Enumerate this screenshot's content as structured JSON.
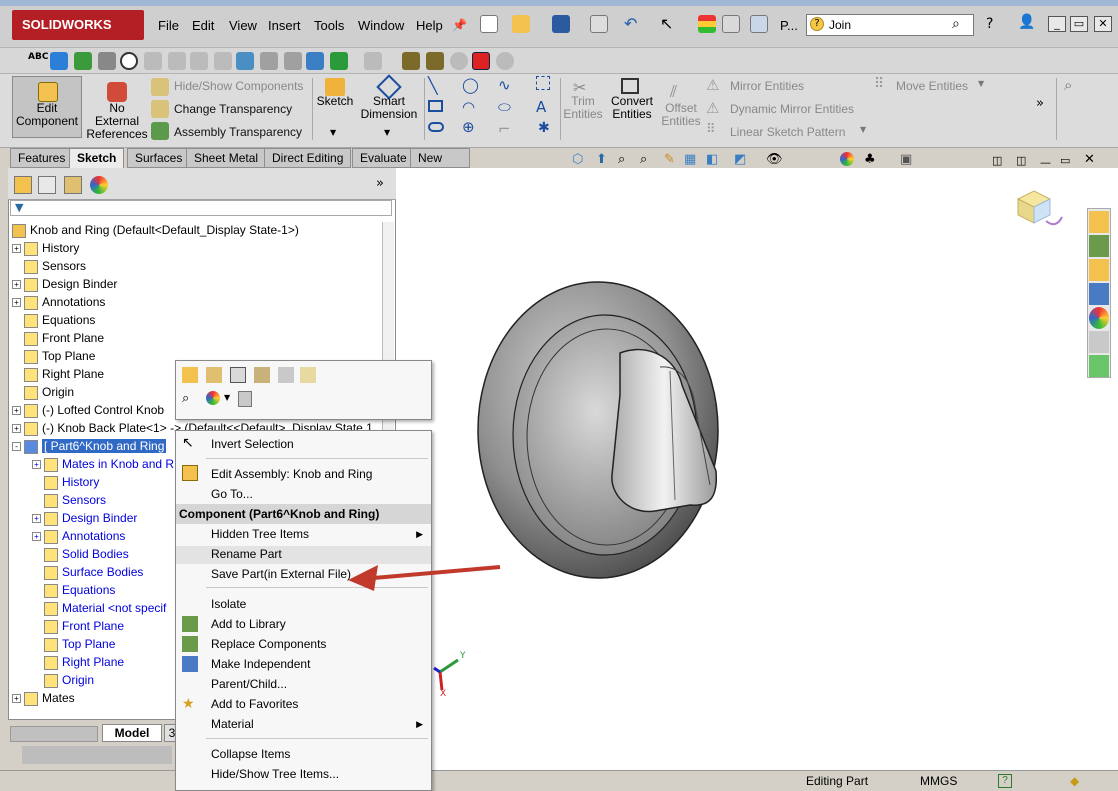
{
  "app": {
    "title": "SOLIDWORKS",
    "search_placeholder": "Join"
  },
  "menubar": {
    "items": [
      "File",
      "Edit",
      "View",
      "Insert",
      "Tools",
      "Window",
      "Help",
      "P..."
    ]
  },
  "ribbon": {
    "edit_component": "Edit Component",
    "no_external_references": "No External References",
    "hide_show_components": "Hide/Show Components",
    "change_transparency": "Change Transparency",
    "assembly_transparency": "Assembly Transparency",
    "sketch": "Sketch",
    "smart_dimension": "Smart Dimension",
    "trim_entities": "Trim Entities",
    "convert_entities": "Convert Entities",
    "offset_entities": "Offset Entities",
    "mirror_entities": "Mirror Entities",
    "dynamic_mirror_entities": "Dynamic Mirror Entities",
    "linear_sketch_pattern": "Linear Sketch Pattern",
    "move_entities": "Move Entities"
  },
  "tabs": [
    "Features",
    "Sketch",
    "Surfaces",
    "Sheet Metal",
    "Direct Editing",
    "Evaluate",
    "New Tab"
  ],
  "tree": {
    "root": "Knob and Ring  (Default<Default_Display State-1>)",
    "items": [
      {
        "label": "History",
        "expand": "+",
        "color": "black"
      },
      {
        "label": "Sensors",
        "expand": "",
        "color": "black"
      },
      {
        "label": "Design Binder",
        "expand": "+",
        "color": "black"
      },
      {
        "label": "Annotations",
        "expand": "+",
        "color": "black"
      },
      {
        "label": "Equations",
        "expand": "",
        "color": "black"
      },
      {
        "label": "Front Plane",
        "expand": "",
        "color": "black"
      },
      {
        "label": "Top Plane",
        "expand": "",
        "color": "black"
      },
      {
        "label": "Right Plane",
        "expand": "",
        "color": "black"
      },
      {
        "label": "Origin",
        "expand": "",
        "color": "black"
      },
      {
        "label": "(-) Lofted Control Knob",
        "expand": "+",
        "color": "black"
      },
      {
        "label": "(-) Knob Back Plate<1> -> (Default<<Default>_Display State 1",
        "expand": "+",
        "color": "black"
      },
      {
        "label": "[ Part6^Knob and Ring",
        "expand": "-",
        "color": "selected"
      },
      {
        "label": "Mates in Knob and R",
        "expand": "+",
        "color": "blue"
      },
      {
        "label": "History",
        "expand": "",
        "color": "blue"
      },
      {
        "label": "Sensors",
        "expand": "",
        "color": "blue"
      },
      {
        "label": "Design Binder",
        "expand": "+",
        "color": "blue"
      },
      {
        "label": "Annotations",
        "expand": "+",
        "color": "blue"
      },
      {
        "label": "Solid Bodies",
        "expand": "",
        "color": "blue"
      },
      {
        "label": "Surface Bodies",
        "expand": "",
        "color": "blue"
      },
      {
        "label": "Equations",
        "expand": "",
        "color": "blue"
      },
      {
        "label": "Material <not specif",
        "expand": "",
        "color": "blue"
      },
      {
        "label": "Front Plane",
        "expand": "",
        "color": "blue"
      },
      {
        "label": "Top Plane",
        "expand": "",
        "color": "blue"
      },
      {
        "label": "Right Plane",
        "expand": "",
        "color": "blue"
      },
      {
        "label": "Origin",
        "expand": "",
        "color": "blue"
      },
      {
        "label": "Mates",
        "expand": "+",
        "color": "black"
      }
    ]
  },
  "bottom_tabs": {
    "model": "Model",
    "three": "3"
  },
  "context_menu": {
    "invert_selection": "Invert Selection",
    "edit_assembly": "Edit Assembly: Knob and Ring",
    "go_to": "Go To...",
    "header": "Component (Part6^Knob and Ring)",
    "hidden_tree_items": "Hidden Tree Items",
    "rename_part": "Rename Part",
    "save_part": "Save Part(in External File)",
    "isolate": "Isolate",
    "add_to_library": "Add to Library",
    "replace_components": "Replace Components",
    "make_independent": "Make Independent",
    "parent_child": "Parent/Child...",
    "add_to_favorites": "Add to Favorites",
    "material": "Material",
    "collapse_items": "Collapse Items",
    "hide_show_tree_items": "Hide/Show Tree Items..."
  },
  "status": {
    "mode": "Editing Part",
    "units": "MMGS"
  },
  "triad": {
    "x": "X",
    "y": "Y"
  },
  "colors": {
    "selected": "#316ac5",
    "annotation_arrow": "#c0392b",
    "tree_blue": "#0000e0"
  }
}
